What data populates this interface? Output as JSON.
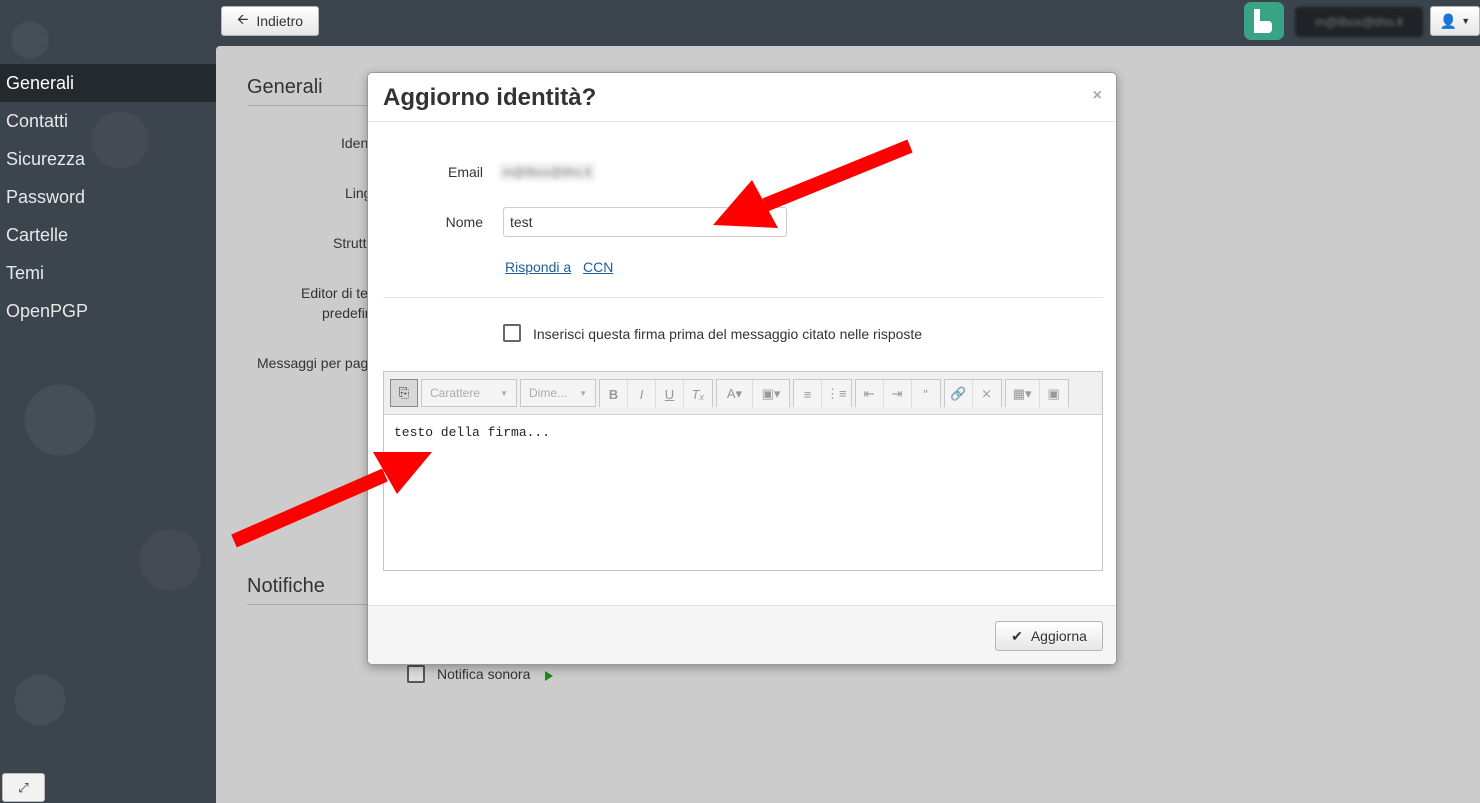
{
  "topbar": {
    "back_label": "Indietro",
    "user_email": "m@ilbox@tiho.it"
  },
  "sidebar": {
    "items": [
      {
        "label": "Generali"
      },
      {
        "label": "Contatti"
      },
      {
        "label": "Sicurezza"
      },
      {
        "label": "Password"
      },
      {
        "label": "Cartelle"
      },
      {
        "label": "Temi"
      },
      {
        "label": "OpenPGP"
      }
    ]
  },
  "background": {
    "section_generali": "Generali",
    "section_notifiche": "Notifiche",
    "labels": [
      "Iden",
      "Ling",
      "Strutt",
      "Editor di te",
      "predefin",
      "Messaggi per pag"
    ],
    "notifica_sonora": "Notifica sonora"
  },
  "modal": {
    "title": "Aggiorno identità?",
    "close": "×",
    "email_label": "Email",
    "email_value": "m@ilbox@tiho.it",
    "name_label": "Nome",
    "name_value": "test",
    "reply_link": "Rispondi a",
    "bcc_link": "CCN",
    "signature_checkbox_label": "Inserisci questa firma prima del messaggio citato nelle risposte",
    "editor": {
      "font_placeholder": "Carattere",
      "size_placeholder": "Dime...",
      "content": "testo della firma..."
    },
    "update_label": "Aggiorna"
  },
  "colors": {
    "annotation_arrow": "#ff0000",
    "brand_logo": "#3aa383"
  }
}
